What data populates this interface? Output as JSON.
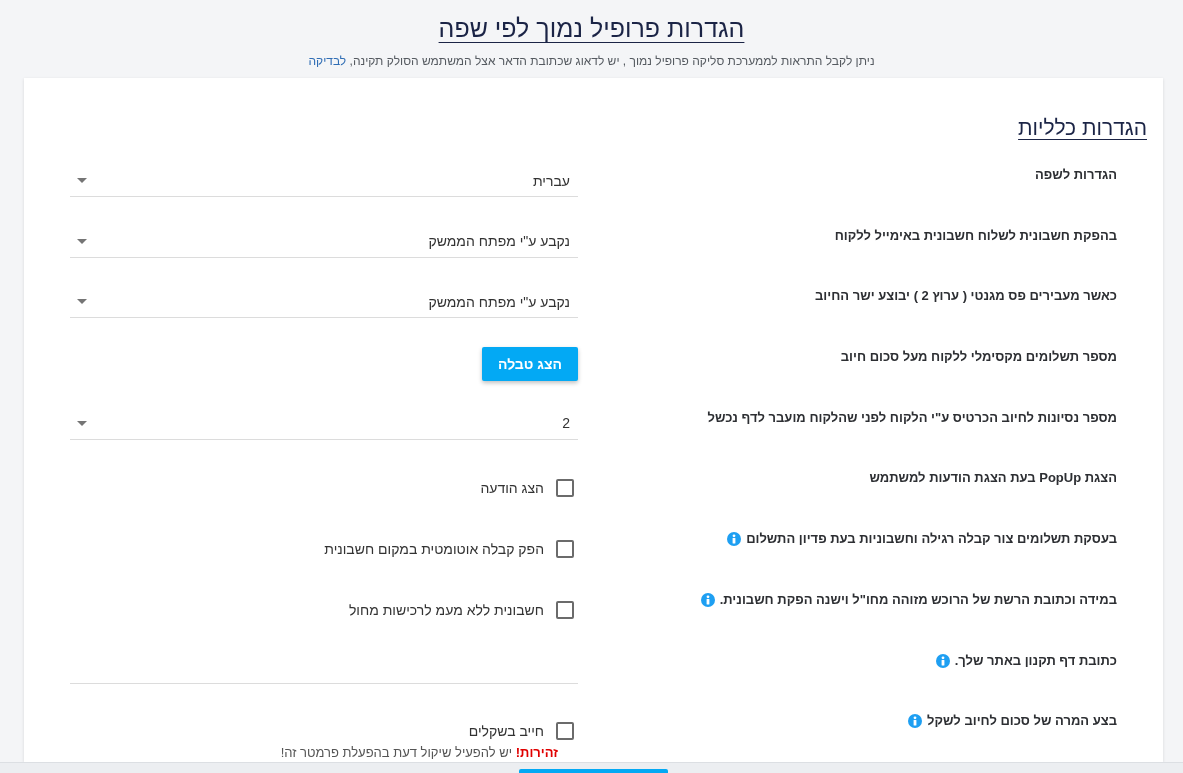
{
  "header": {
    "title": "הגדרות פרופיל נמוך לפי שפה",
    "note": "ניתן לקבל התראות לממערכת סליקה פרופיל נמוך , יש לדאוג שכתובת הדאר אצל המשתמש הסולק תקינה,",
    "note_link": "לבדיקה"
  },
  "section": {
    "title": "הגדרות כלליות"
  },
  "settings": [
    {
      "label": "הגדרות לשפה",
      "info": false,
      "control": {
        "kind": "select",
        "value": "עברית"
      }
    },
    {
      "label": "בהפקת חשבונית לשלוח חשבונית באימייל ללקוח",
      "info": false,
      "control": {
        "kind": "select",
        "value": "נקבע ע\"י מפתח הממשק"
      }
    },
    {
      "label": "כאשר מעבירים פס מגנטי ( ערוץ 2 ) יבוצע ישר החיוב",
      "info": false,
      "control": {
        "kind": "select",
        "value": "נקבע ע\"י מפתח הממשק"
      }
    },
    {
      "label": "מספר תשלומים מקסימלי ללקוח מעל סכום חיוב",
      "info": false,
      "control": {
        "kind": "button",
        "label": "הצג טבלה"
      }
    },
    {
      "label": "מספר נסיונות לחיוב הכרטיס ע\"י הלקוח לפני שהלקוח מועבר לדף נכשל",
      "info": false,
      "control": {
        "kind": "select",
        "value": "2"
      }
    },
    {
      "label": "הצגת PopUp בעת הצגת הודעות למשתמש",
      "info": false,
      "control": {
        "kind": "checkbox",
        "label": "הצג הודעה",
        "checked": false
      }
    },
    {
      "label": "בעסקת תשלומים צור קבלה רגילה וחשבוניות בעת פדיון התשלום",
      "info": true,
      "control": {
        "kind": "checkbox",
        "label": "הפק קבלה אוטומטית במקום חשבונית",
        "checked": false
      }
    },
    {
      "label": "במידה וכתובת הרשת של הרוכש מזוהה מחו\"ל וישנה הפקת חשבונית.",
      "info": true,
      "control": {
        "kind": "checkbox",
        "label": "חשבונית ללא מעמ לרכישות מחול",
        "checked": false
      }
    },
    {
      "label": "כתובת דף תקנון באתר שלך.",
      "info": true,
      "control": {
        "kind": "text"
      }
    },
    {
      "label": "בצע המרה של סכום לחיוב לשקל",
      "info": true,
      "control": {
        "kind": "checkbox",
        "label": "חייב בשקלים",
        "checked": false,
        "warning": "**זהירות!** יש להפעיל שיקול דעת בהפעלת פרמטר זה!"
      }
    }
  ]
}
